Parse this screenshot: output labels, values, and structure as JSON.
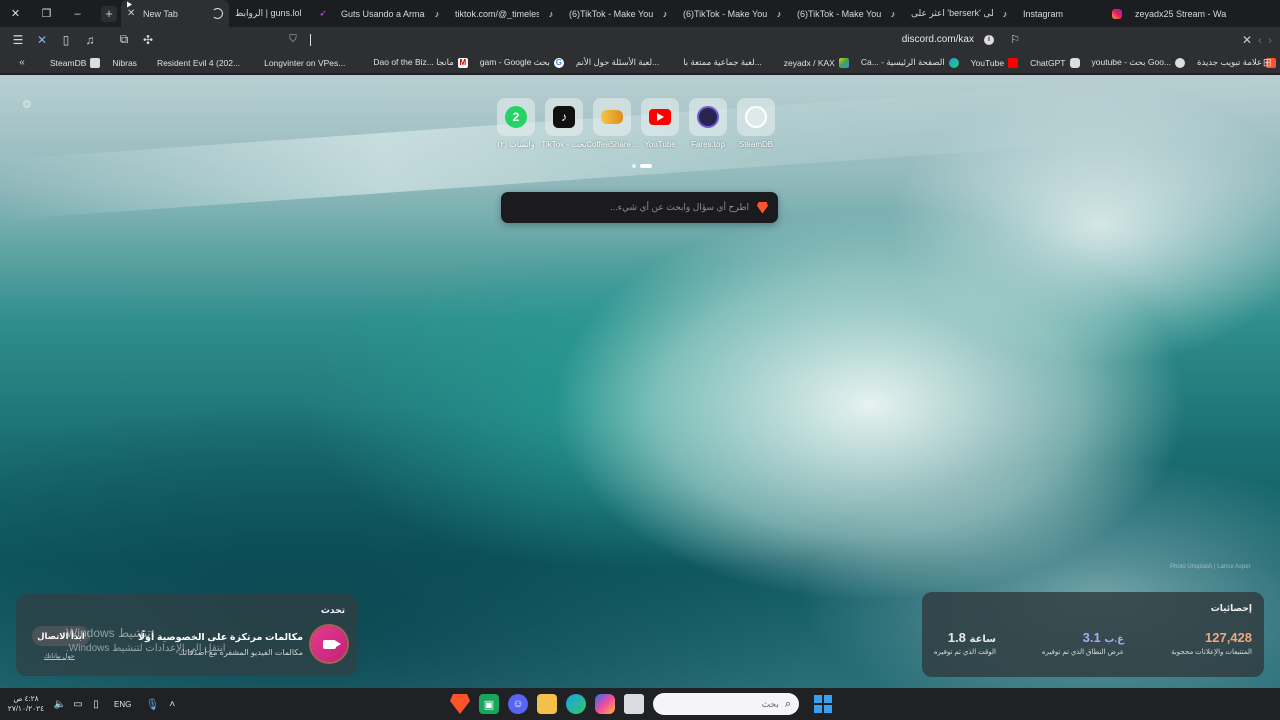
{
  "tabs": [
    {
      "title": "New Tab",
      "active": true
    },
    {
      "title": "الروابط | guns.lol",
      "icon": "spinner-icon"
    },
    {
      "title": "Guts Usando a Armadu",
      "icon": "purple-arrow-icon"
    },
    {
      "title": "tiktok.com/@_timeless",
      "icon": "tiktok-icon"
    },
    {
      "title": "(6)TikTok - Make Your D",
      "icon": "tiktok-icon"
    },
    {
      "title": "(6)TikTok - Make Your D",
      "icon": "tiktok-icon"
    },
    {
      "title": "(6)TikTok - Make Your D",
      "icon": "tiktok-icon"
    },
    {
      "title": "اعثر على 'berserk' على",
      "icon": "tiktok-icon"
    },
    {
      "title": "Instagram",
      "icon": "instagram-icon"
    },
    {
      "title": "zeyadx25 Stream - Wa",
      "icon": ""
    }
  ],
  "address_bar": {
    "url": "discord.com/kax"
  },
  "bookmarks": [
    {
      "label": "SteamDB",
      "icon": "steamdb-icon"
    },
    {
      "label": "Nibras",
      "icon": "nibras-icon"
    },
    {
      "label": "Resident Evil 4 (202...",
      "icon": ""
    },
    {
      "label": "Longvinter on VPes...",
      "icon": ""
    },
    {
      "label": "Dao of the Biz... مانجا",
      "icon": "manga-icon"
    },
    {
      "label": "gam - Google بحث",
      "icon": "google-icon"
    },
    {
      "label": "لعبة الأسئلة حول الأنم...",
      "icon": ""
    },
    {
      "label": "لعبة جماعية ممتعة با...",
      "icon": ""
    },
    {
      "label": "zeyadx / KAX",
      "icon": "drive-icon"
    },
    {
      "label": "Ca... - الصفحة الرئيسية",
      "icon": "edge-icon"
    },
    {
      "label": "YouTube",
      "icon": "youtube-icon"
    },
    {
      "label": "ChatGPT",
      "icon": "chatgpt-icon"
    },
    {
      "label": "youtube - بحث Goo...",
      "icon": "google-icon"
    },
    {
      "label": "علامة تبويب جديدة",
      "icon": "brave-icon"
    }
  ],
  "top_sites": [
    {
      "label": "(٢) واتساب",
      "icon": "whatsapp-icon",
      "badge": "2"
    },
    {
      "label": "TikTok - بحث",
      "icon": "tiktok-icon"
    },
    {
      "label": "CoffeeShare...",
      "icon": "coffeeshare-icon"
    },
    {
      "label": "YouTube",
      "icon": "youtube-icon"
    },
    {
      "label": "Fares.top",
      "icon": "fares-icon"
    },
    {
      "label": "SteamDB",
      "icon": "steamdb-icon"
    }
  ],
  "search": {
    "placeholder": "اطرح أي سؤال وابحث عن أي شيء..."
  },
  "talk_panel": {
    "title": "تحدث",
    "heading": "مكالمات مرتكزة على الخصوصية أولًا",
    "subtitle": "مكالمات الفيديو المشفرة مع أصدقائك",
    "button": "ابدأ الاتصال",
    "link": "حول بياناتك"
  },
  "windows_watermark": {
    "line1": "Windows تنشيط",
    "line2": "انتقل إلى الإعدادات لتنشيط Windows."
  },
  "stats_panel": {
    "title": "إحصائيات",
    "items": [
      {
        "value": "127,428",
        "unit": "",
        "label": "المتتبعات والإعلانات محجوبة",
        "color": "#f0a77d"
      },
      {
        "value": "3.1",
        "unit": "غ.ب",
        "label": "عرض النطاق الذي تم توفيره",
        "color": "#a9a8f4"
      },
      {
        "value": "1.8",
        "unit": "ساعة",
        "label": "الوقت الذي تم توفيره",
        "color": "#ffffff"
      }
    ]
  },
  "photo_credit": "Photo Unsplash | Lance Asper",
  "taskbar": {
    "clock_time": "٤:٢٨ ص",
    "clock_date": "٢٧/١٠/٢٠٢٤",
    "lang": "ENG",
    "search_placeholder": "بحث"
  }
}
